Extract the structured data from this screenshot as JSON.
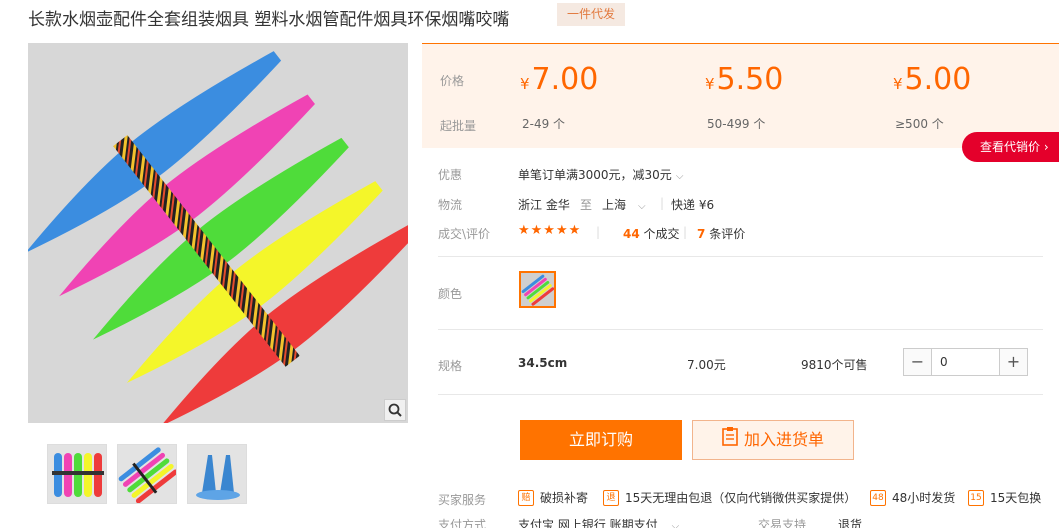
{
  "title": "长款水烟壶配件全套组装烟具 塑料水烟管配件烟具环保烟嘴咬嘴",
  "badge": "一件代发",
  "price_box": {
    "price_label": "价格",
    "qty_label": "起批量",
    "currency": "¥",
    "tiers": [
      {
        "price": "7.00",
        "qty": "2-49 个"
      },
      {
        "price": "5.50",
        "qty": "50-499 个"
      },
      {
        "price": "5.00",
        "qty": "≥500 个"
      }
    ]
  },
  "agent_button": "查看代销价",
  "info": {
    "discount_label": "优惠",
    "discount_value": "单笔订单满3000元，减30元",
    "logistics_label": "物流",
    "origin": "浙江 金华",
    "to": "至",
    "destination": "上海",
    "express": "快递 ¥6",
    "deals_label": "成交\\评价",
    "stars": "★★★★★",
    "deal_count": "44",
    "deal_suffix": "个成交",
    "review_count": "7",
    "review_suffix": "条评价"
  },
  "color": {
    "label": "颜色"
  },
  "spec": {
    "label": "规格",
    "name": "34.5cm",
    "price": "7.00元",
    "stock": "9810个可售",
    "quantity": "0",
    "minus": "−",
    "plus": "+"
  },
  "actions": {
    "buy": "立即订购",
    "cart": "加入进货单"
  },
  "services": {
    "label": "买家服务",
    "items": [
      {
        "icon": "赔",
        "text": "破损补寄"
      },
      {
        "icon": "退",
        "text": "15天无理由包退（仅向代销微供买家提供）"
      },
      {
        "icon": "48",
        "text": "48小时发货"
      },
      {
        "icon": "15",
        "text": "15天包换"
      }
    ]
  },
  "payment": {
    "label": "支付方式",
    "methods": "支付宝  网上银行  账期支付",
    "trade_label": "交易支持",
    "trade_value": "退货"
  },
  "colors": {
    "accent": "#ff7300",
    "price": "#ff6600",
    "agent": "#e4002b"
  }
}
